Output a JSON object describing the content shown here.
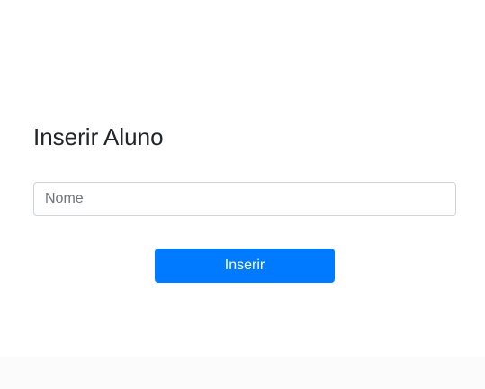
{
  "form": {
    "title": "Inserir Aluno",
    "name_input": {
      "placeholder": "Nome",
      "value": ""
    },
    "submit_label": "Inserir"
  },
  "colors": {
    "primary": "#007bff",
    "text": "#212529",
    "input_border": "#ced4da",
    "placeholder": "#6c757d"
  }
}
